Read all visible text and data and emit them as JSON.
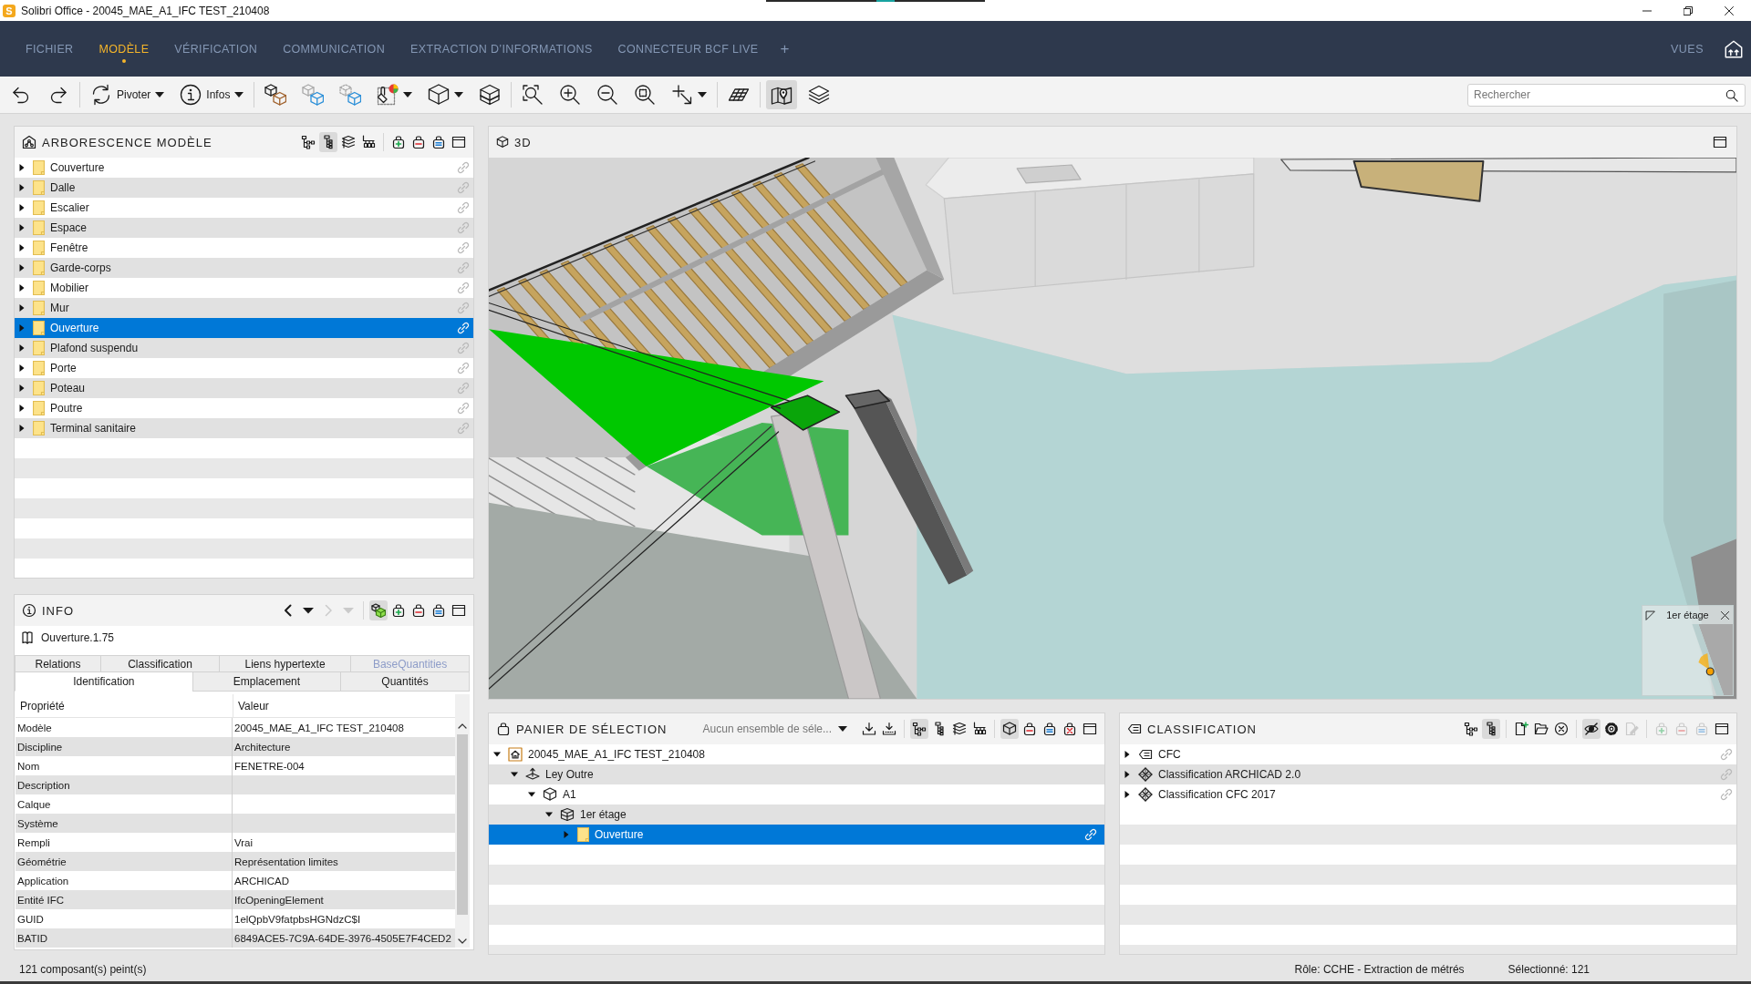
{
  "window": {
    "logo": "S",
    "title": "Solibri Office - 20045_MAE_A1_IFC TEST_210408"
  },
  "menu": {
    "tabs": [
      {
        "label": "FICHIER",
        "selected": false
      },
      {
        "label": "MODÈLE",
        "selected": true
      },
      {
        "label": "VÉRIFICATION",
        "selected": false
      },
      {
        "label": "COMMUNICATION",
        "selected": false
      },
      {
        "label": "EXTRACTION D’INFORMATIONS",
        "selected": false
      },
      {
        "label": "CONNECTEUR BCF LIVE",
        "selected": false
      }
    ],
    "add_tab": "+",
    "views": "VUES"
  },
  "toolbar": {
    "groups": [
      {
        "items": [
          {
            "kind": "undo",
            "pressed": false,
            "dropdown": false
          },
          {
            "kind": "redo",
            "pressed": false,
            "dropdown": false
          }
        ]
      },
      {
        "items": [
          {
            "kind": "rotate",
            "label": "Pivoter",
            "pressed": false,
            "dropdown": true
          },
          {
            "kind": "info",
            "label": "Infos",
            "pressed": false,
            "dropdown": true
          }
        ]
      },
      {
        "items": [
          {
            "kind": "cubes",
            "pressed": false,
            "dropdown": false
          },
          {
            "kind": "ghost",
            "pressed": false,
            "dropdown": false
          },
          {
            "kind": "dashed",
            "pressed": false,
            "dropdown": false
          },
          {
            "kind": "paint",
            "pressed": false,
            "dropdown": true
          },
          {
            "kind": "cube",
            "pressed": false,
            "dropdown": true
          },
          {
            "kind": "floorbox",
            "pressed": false,
            "dropdown": false
          }
        ]
      },
      {
        "items": [
          {
            "kind": "zoomfit",
            "pressed": false,
            "dropdown": false
          },
          {
            "kind": "zoomin",
            "pressed": false,
            "dropdown": false
          },
          {
            "kind": "zoomout",
            "pressed": false,
            "dropdown": false
          },
          {
            "kind": "zoomsel",
            "pressed": false,
            "dropdown": false
          },
          {
            "kind": "select",
            "pressed": false,
            "dropdown": true
          }
        ]
      },
      {
        "items": [
          {
            "kind": "grid",
            "pressed": false,
            "dropdown": false
          }
        ]
      },
      {
        "items": [
          {
            "kind": "map",
            "pressed": true,
            "dropdown": false
          },
          {
            "kind": "layers",
            "pressed": false,
            "dropdown": false
          }
        ]
      }
    ],
    "search": {
      "placeholder": "Rechercher"
    }
  },
  "model_tree": {
    "title": "ARBORESCENCE MODÈLE",
    "tool_groups": [
      {
        "tools": [
          {
            "kind": "hierarchy",
            "pressed": false,
            "disabled": false
          },
          {
            "kind": "tree",
            "pressed": true,
            "disabled": false
          },
          {
            "kind": "stack",
            "pressed": false,
            "disabled": false
          },
          {
            "kind": "branch",
            "pressed": false,
            "disabled": false
          }
        ]
      },
      {
        "tools": [
          {
            "kind": "bagplus",
            "pressed": false,
            "disabled": false
          },
          {
            "kind": "bagminus",
            "pressed": false,
            "disabled": false
          },
          {
            "kind": "bagequal",
            "pressed": false,
            "disabled": false
          },
          {
            "kind": "window",
            "pressed": false,
            "disabled": false
          }
        ]
      }
    ],
    "items": [
      {
        "label": "Couverture",
        "expanded": false,
        "selected": false
      },
      {
        "label": "Dalle",
        "expanded": false,
        "selected": false
      },
      {
        "label": "Escalier",
        "expanded": false,
        "selected": false
      },
      {
        "label": "Espace",
        "expanded": false,
        "selected": false
      },
      {
        "label": "Fenêtre",
        "expanded": false,
        "selected": false
      },
      {
        "label": "Garde-corps",
        "expanded": false,
        "selected": false
      },
      {
        "label": "Mobilier",
        "expanded": false,
        "selected": false
      },
      {
        "label": "Mur",
        "expanded": false,
        "selected": false
      },
      {
        "label": "Ouverture",
        "expanded": false,
        "selected": true
      },
      {
        "label": "Plafond suspendu",
        "expanded": false,
        "selected": false
      },
      {
        "label": "Porte",
        "expanded": false,
        "selected": false
      },
      {
        "label": "Poteau",
        "expanded": false,
        "selected": false
      },
      {
        "label": "Poutre",
        "expanded": false,
        "selected": false
      },
      {
        "label": "Terminal sanitaire",
        "expanded": false,
        "selected": false
      }
    ]
  },
  "viewport": {
    "title": "3D",
    "minimap": {
      "title": "1er étage"
    }
  },
  "info": {
    "title": "INFO",
    "tool_groups": [
      {
        "tools": [
          {
            "kind": "back",
            "pressed": false,
            "disabled": false
          },
          {
            "kind": "history",
            "pressed": false,
            "disabled": false
          },
          {
            "kind": "forward",
            "pressed": false,
            "disabled": true
          },
          {
            "kind": "history",
            "pressed": false,
            "disabled": true
          }
        ]
      },
      {
        "tools": [
          {
            "kind": "greencubes",
            "pressed": true,
            "disabled": false
          },
          {
            "kind": "bagplus",
            "pressed": false,
            "disabled": false
          },
          {
            "kind": "bagminus",
            "pressed": false,
            "disabled": false
          },
          {
            "kind": "bagequal",
            "pressed": false,
            "disabled": false
          },
          {
            "kind": "window",
            "pressed": false,
            "disabled": false
          }
        ]
      }
    ],
    "object": "Ouverture.1.75",
    "tab_rows": [
      {
        "tabs": [
          {
            "label": "Relations",
            "selected": false,
            "disabled": false
          },
          {
            "label": "Classification",
            "selected": false,
            "disabled": false
          },
          {
            "label": "Liens hypertexte",
            "selected": false,
            "disabled": false
          },
          {
            "label": "BaseQuantities",
            "selected": false,
            "disabled": true
          }
        ]
      },
      {
        "tabs": [
          {
            "label": "Identification",
            "selected": true,
            "disabled": false
          },
          {
            "label": "Emplacement",
            "selected": false,
            "disabled": false
          },
          {
            "label": "Quantités",
            "selected": false,
            "disabled": false
          }
        ]
      }
    ],
    "columns": [
      "Propriété",
      "Valeur"
    ],
    "rows": [
      {
        "property": "Modèle",
        "value": "20045_MAE_A1_IFC TEST_210408"
      },
      {
        "property": "Discipline",
        "value": "Architecture"
      },
      {
        "property": "Nom",
        "value": "FENETRE-004"
      },
      {
        "property": "Description"
      },
      {
        "property": "Calque"
      },
      {
        "property": "Système"
      },
      {
        "property": "Rempli",
        "value": "Vrai"
      },
      {
        "property": "Géométrie",
        "value": "Représentation limites"
      },
      {
        "property": "Application",
        "value": "ARCHICAD"
      },
      {
        "property": "Entité IFC",
        "value": "IfcOpeningElement"
      },
      {
        "property": "GUID",
        "value": "1elQpbV9fatpbsHGNdzC$I"
      },
      {
        "property": "BATID",
        "value": "6849ACE5-7C9A-64DE-3976-4505E7F4CED2"
      }
    ]
  },
  "selection_basket": {
    "title": "PANIER DE SÉLECTION",
    "set_dropdown": "Aucun ensemble de séle...",
    "tool_groups": [
      {
        "tools": [
          {
            "kind": "download",
            "pressed": false,
            "disabled": false
          },
          {
            "kind": "downloaddots",
            "pressed": false,
            "disabled": false
          }
        ]
      },
      {
        "tools": [
          {
            "kind": "hierarchy",
            "pressed": true,
            "disabled": false
          },
          {
            "kind": "tree",
            "pressed": false,
            "disabled": false
          },
          {
            "kind": "stack",
            "pressed": false,
            "disabled": false
          },
          {
            "kind": "branch",
            "pressed": false,
            "disabled": false
          }
        ]
      },
      {
        "tools": [
          {
            "kind": "cube16",
            "pressed": true,
            "disabled": false
          },
          {
            "kind": "bagminus",
            "pressed": false,
            "disabled": false
          },
          {
            "kind": "bagequal",
            "pressed": false,
            "disabled": false
          },
          {
            "kind": "bagx",
            "pressed": false,
            "disabled": false
          },
          {
            "kind": "window",
            "pressed": false,
            "disabled": false
          }
        ]
      }
    ],
    "tree": [
      {
        "label": "20045_MAE_A1_IFC TEST_210408",
        "kind": "model",
        "expanded": true,
        "selected": false,
        "children": [
          {
            "label": "Ley Outre",
            "kind": "site",
            "expanded": true,
            "selected": false,
            "children": [
              {
                "label": "A1",
                "kind": "building",
                "expanded": true,
                "selected": false,
                "children": [
                  {
                    "label": "1er étage",
                    "kind": "storey",
                    "expanded": true,
                    "selected": false,
                    "children": [
                      {
                        "label": "Ouverture",
                        "kind": "folder",
                        "expanded": false,
                        "selected": true
                      }
                    ]
                  }
                ]
              }
            ]
          }
        ]
      }
    ]
  },
  "classification": {
    "title": "CLASSIFICATION",
    "tool_groups": [
      {
        "tools": [
          {
            "kind": "hierarchy",
            "pressed": false,
            "disabled": false
          },
          {
            "kind": "tree",
            "pressed": true,
            "disabled": false
          }
        ]
      },
      {
        "tools": [
          {
            "kind": "docplus",
            "pressed": false,
            "disabled": false
          },
          {
            "kind": "folderopen",
            "pressed": false,
            "disabled": false
          },
          {
            "kind": "circlex",
            "pressed": false,
            "disabled": false
          }
        ]
      },
      {
        "tools": [
          {
            "kind": "eyeoff",
            "pressed": true,
            "disabled": false
          },
          {
            "kind": "gear",
            "pressed": false,
            "disabled": false
          },
          {
            "kind": "docedit",
            "pressed": false,
            "disabled": true
          }
        ]
      },
      {
        "tools": [
          {
            "kind": "bagplus",
            "pressed": false,
            "disabled": true
          },
          {
            "kind": "bagminus",
            "pressed": false,
            "disabled": true
          },
          {
            "kind": "bagequal",
            "pressed": false,
            "disabled": true
          },
          {
            "kind": "window",
            "pressed": false,
            "disabled": false
          }
        ]
      }
    ],
    "items": [
      {
        "label": "CFC",
        "kind": "tag",
        "expanded": false,
        "selected": false
      },
      {
        "label": "Classification ARCHICAD 2.0",
        "kind": "scheme",
        "expanded": false,
        "selected": false
      },
      {
        "label": "Classification CFC 2017",
        "kind": "scheme",
        "expanded": false,
        "selected": false
      }
    ]
  },
  "status_bar": {
    "painted": "121 composant(s) peint(s)",
    "role": "Rôle: CCHE - Extraction de métrés",
    "selected": "Sélectionné: 121"
  }
}
